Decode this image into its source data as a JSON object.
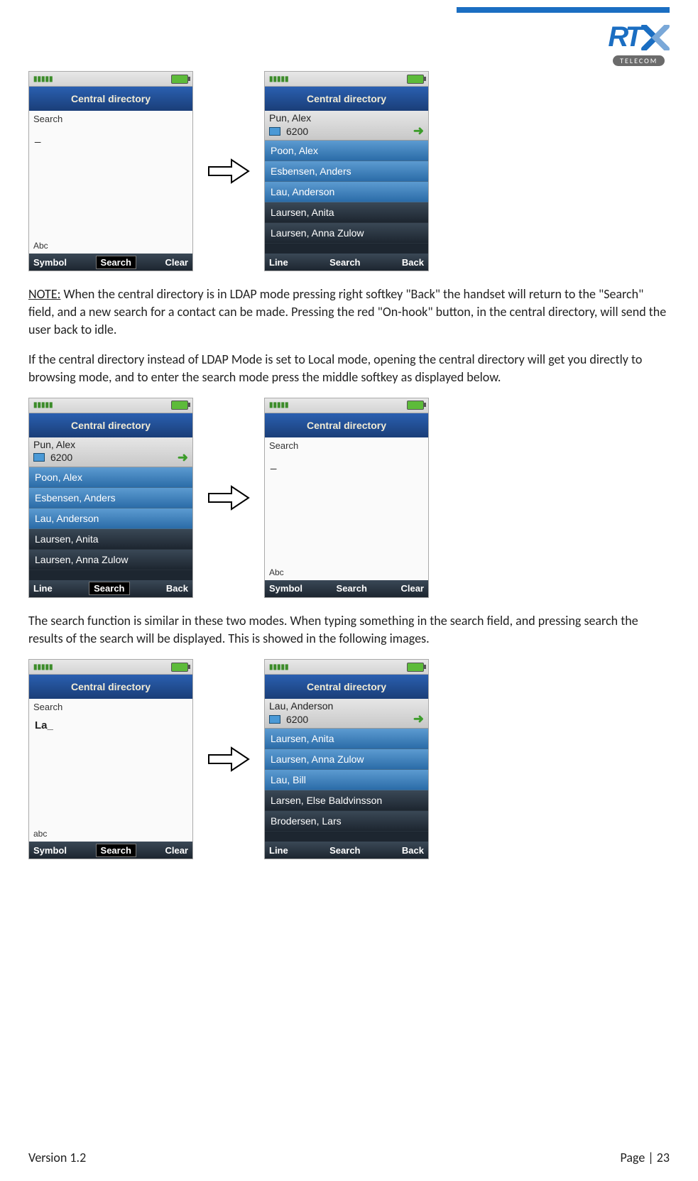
{
  "logo": {
    "rt": "RT",
    "sub": "TELECOM"
  },
  "ph1": {
    "title": "Central directory",
    "search": "Search",
    "cursor": "_",
    "abc": "Abc",
    "sk": [
      "Symbol",
      "Search",
      "Clear"
    ]
  },
  "ph2": {
    "title": "Central directory",
    "sel": {
      "name": "Pun, Alex",
      "num": "6200"
    },
    "rows": [
      "Poon, Alex",
      "Esbensen, Anders",
      "Lau, Anderson",
      "Laursen, Anita",
      "Laursen, Anna Zulow"
    ],
    "sk": [
      "Line",
      "Search",
      "Back"
    ]
  },
  "para1_a": "NOTE:",
  "para1_b": " When the central directory is in LDAP mode pressing right softkey \"Back\" the handset will return to the \"Search\" field, and a new search for a contact can be made. Pressing the red \"On-hook\" button, in the central directory, will send the user back to idle.",
  "para2": "If the central directory instead of LDAP Mode is set to Local mode, opening the central directory will get you directly to browsing mode, and to enter the search mode press the middle softkey as displayed below.",
  "ph3": {
    "title": "Central directory",
    "sel": {
      "name": "Pun, Alex",
      "num": "6200"
    },
    "rows": [
      "Poon, Alex",
      "Esbensen, Anders",
      "Lau, Anderson",
      "Laursen, Anita",
      "Laursen, Anna Zulow"
    ],
    "sk": [
      "Line",
      "Search",
      "Back"
    ]
  },
  "ph4": {
    "title": "Central directory",
    "search": "Search",
    "cursor": "_",
    "abc": "Abc",
    "sk": [
      "Symbol",
      "Search",
      "Clear"
    ]
  },
  "para3": "The search function is similar in these two modes. When typing something in the search field, and pressing search the results of the search will be displayed. This is showed in the following images.",
  "ph5": {
    "title": "Central directory",
    "search": "Search",
    "cursor": "La_",
    "abc": "abc",
    "sk": [
      "Symbol",
      "Search",
      "Clear"
    ]
  },
  "ph6": {
    "title": "Central directory",
    "sel": {
      "name": "Lau, Anderson",
      "num": "6200"
    },
    "rows": [
      "Laursen, Anita",
      "Laursen, Anna Zulow",
      "Lau, Bill",
      "Larsen, Else Baldvinsson",
      "Brodersen, Lars"
    ],
    "sk": [
      "Line",
      "Search",
      "Back"
    ]
  },
  "footer": {
    "version": "Version 1.2",
    "page": "Page | 23"
  }
}
